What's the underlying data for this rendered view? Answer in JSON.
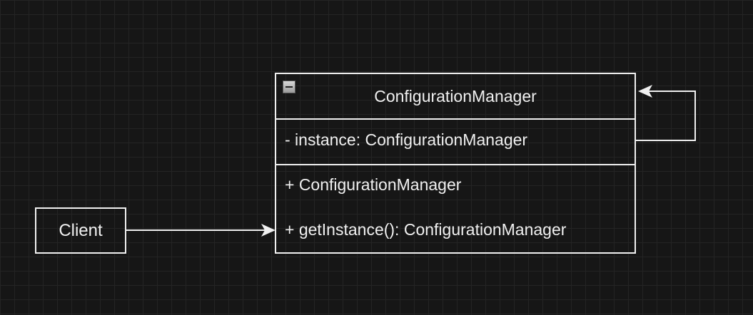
{
  "client": {
    "label": "Client"
  },
  "uml_class": {
    "name": "ConfigurationManager",
    "attributes": [
      {
        "text": "- instance: ConfigurationManager"
      }
    ],
    "methods": [
      {
        "text": "+ ConfigurationManager"
      },
      {
        "text": "+ getInstance(): ConfigurationManager"
      }
    ]
  },
  "colors": {
    "background": "#161616",
    "grid": "#242424",
    "stroke": "#f0f0f0"
  }
}
